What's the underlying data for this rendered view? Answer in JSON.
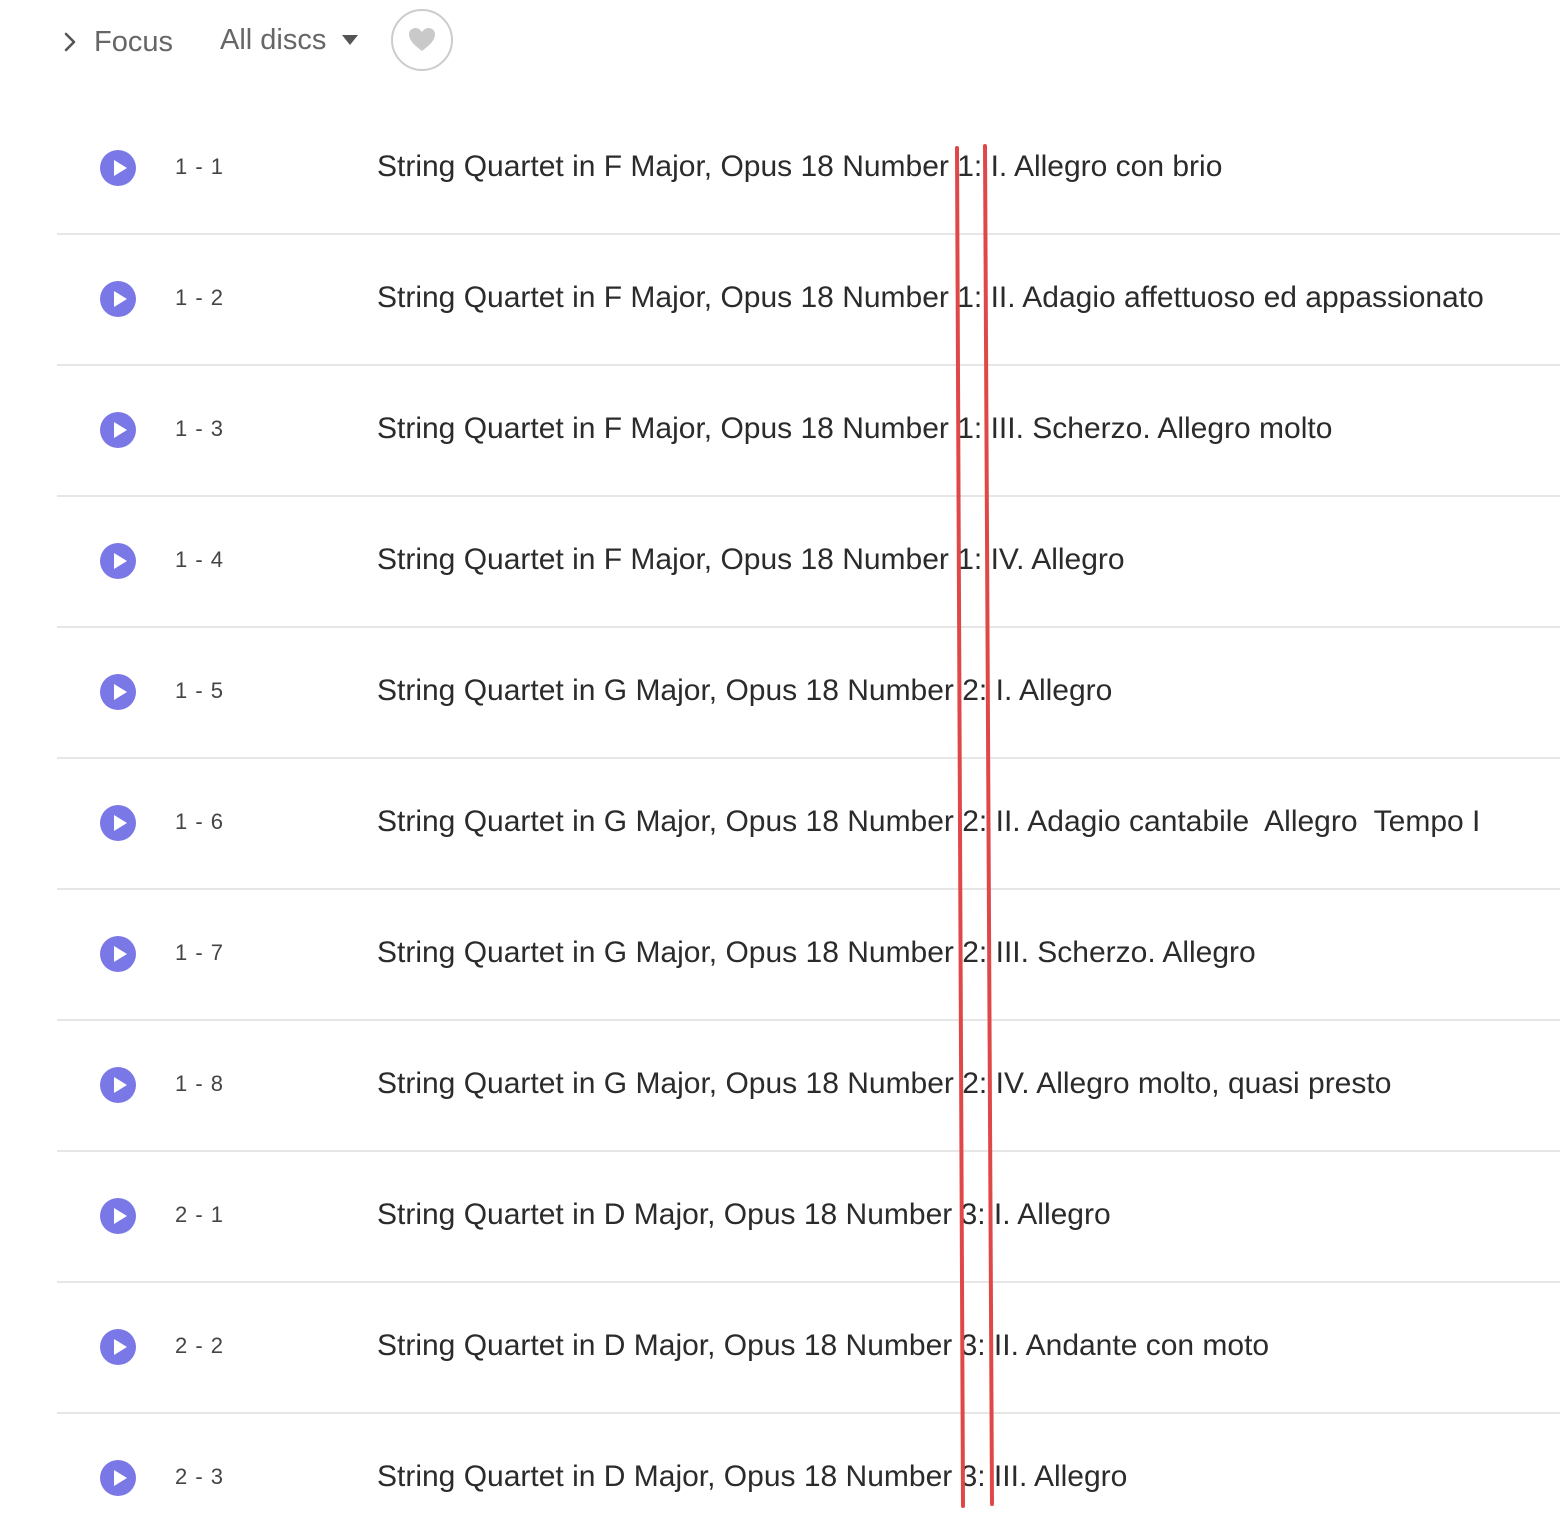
{
  "header": {
    "focus_label": "Focus",
    "discs_label": "All discs",
    "favorite_icon": "heart-icon"
  },
  "colors": {
    "accent": "#7a78e6",
    "annotation": "#e04848",
    "divider": "#e6e6e6"
  },
  "tracks": [
    {
      "number": "1 - 1",
      "title": "String Quartet in F Major, Opus 18 Number 1: I. Allegro con brio"
    },
    {
      "number": "1 - 2",
      "title": "String Quartet in F Major, Opus 18 Number 1: II. Adagio affettuoso ed appassionato"
    },
    {
      "number": "1 - 3",
      "title": "String Quartet in F Major, Opus 18 Number 1: III. Scherzo. Allegro molto"
    },
    {
      "number": "1 - 4",
      "title": "String Quartet in F Major, Opus 18 Number 1: IV. Allegro"
    },
    {
      "number": "1 - 5",
      "title": "String Quartet in G Major, Opus 18 Number 2: I. Allegro"
    },
    {
      "number": "1 - 6",
      "title": "String Quartet in G Major, Opus 18 Number 2: II. Adagio cantabile  Allegro  Tempo I"
    },
    {
      "number": "1 - 7",
      "title": "String Quartet in G Major, Opus 18 Number 2: III. Scherzo. Allegro"
    },
    {
      "number": "1 - 8",
      "title": "String Quartet in G Major, Opus 18 Number 2: IV. Allegro molto, quasi presto"
    },
    {
      "number": "2 - 1",
      "title": "String Quartet in D Major, Opus 18 Number 3: I. Allegro"
    },
    {
      "number": "2 - 2",
      "title": "String Quartet in D Major, Opus 18 Number 3: II. Andante con moto"
    },
    {
      "number": "2 - 3",
      "title": "String Quartet in D Major, Opus 18 Number 3: III. Allegro"
    }
  ]
}
